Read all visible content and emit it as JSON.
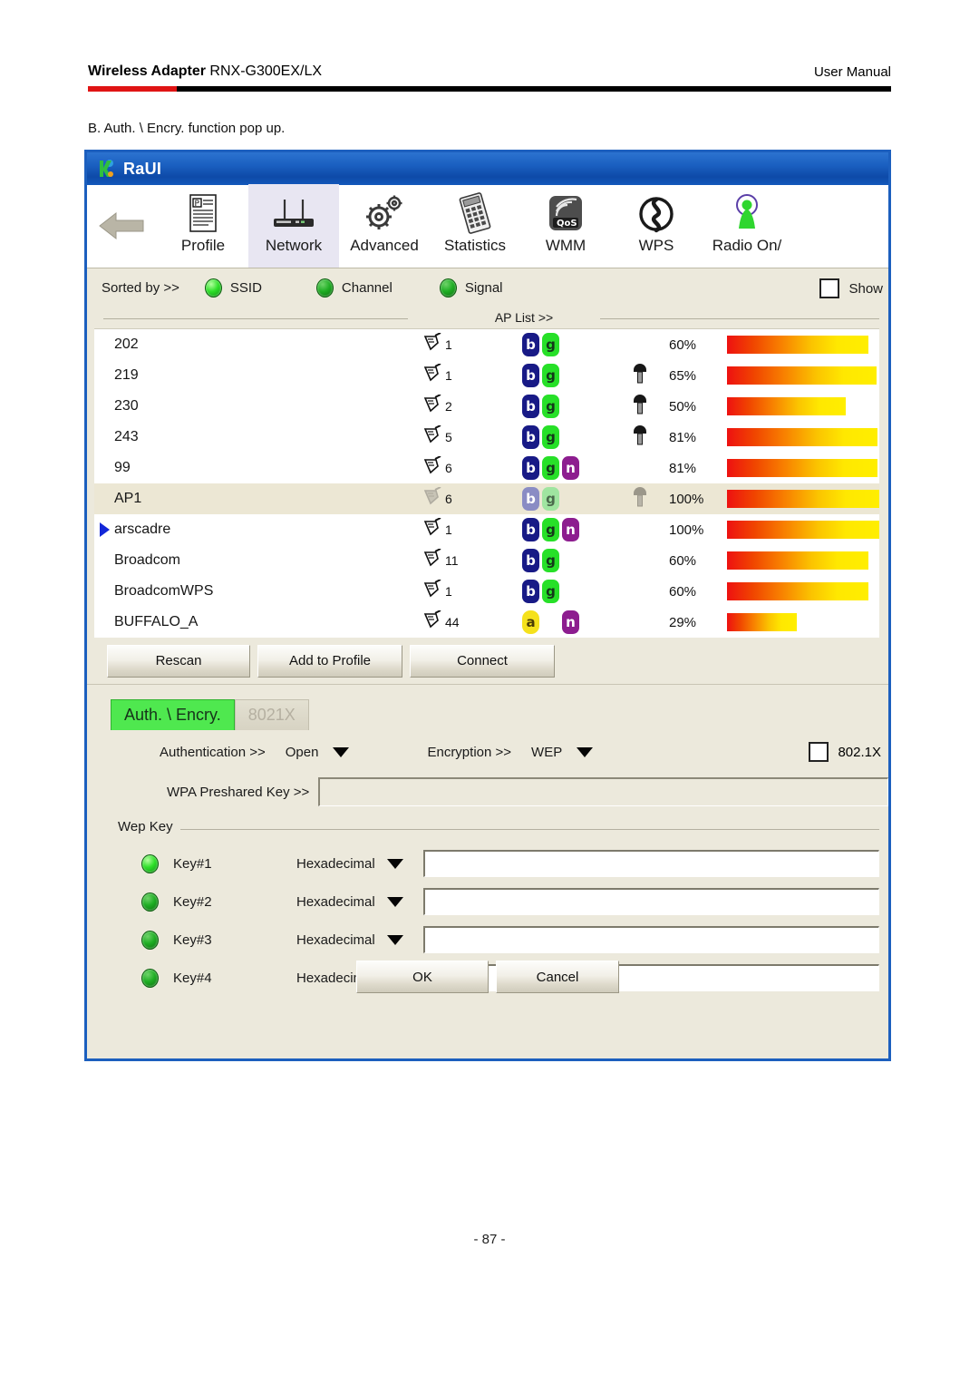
{
  "document": {
    "header_left_bold": "Wireless Adapter",
    "header_left_model": " RNX-G300EX/LX",
    "header_right": "User Manual",
    "caption": "B. Auth. \\ Encry. function pop up.",
    "page_number": "- 87 -",
    "accent_red": "#e01414",
    "accent_black": "#000000"
  },
  "window": {
    "title": "RaUI",
    "titlebar_color": "#1a5fc0",
    "body_color": "#ece9dc",
    "border_color": "#1c5fbe"
  },
  "toolbar": {
    "back_icon": "back-arrow-icon",
    "items": [
      {
        "label": "Profile",
        "icon": "profile-icon",
        "active": false
      },
      {
        "label": "Network",
        "icon": "network-icon",
        "active": true
      },
      {
        "label": "Advanced",
        "icon": "advanced-icon",
        "active": false
      },
      {
        "label": "Statistics",
        "icon": "statistics-icon",
        "active": false
      },
      {
        "label": "WMM",
        "icon": "wmm-qos-icon",
        "active": false
      },
      {
        "label": "WPS",
        "icon": "wps-icon",
        "active": false
      },
      {
        "label": "Radio On/",
        "icon": "radio-onoff-icon",
        "active": false
      }
    ]
  },
  "sortbar": {
    "label": "Sorted by >>",
    "options": [
      {
        "label": "SSID",
        "selected": true
      },
      {
        "label": "Channel",
        "selected": false
      },
      {
        "label": "Signal",
        "selected": false
      }
    ],
    "show_checkbox": {
      "label": "Show",
      "checked": false
    }
  },
  "ap_list": {
    "header": "AP List >>",
    "rows": [
      {
        "ssid": "202",
        "channel": "1",
        "caps": [
          "b",
          "g"
        ],
        "locked": false,
        "signal": "60%",
        "signal_value": 60,
        "selected": false,
        "marked": false,
        "dimmed": false
      },
      {
        "ssid": "219",
        "channel": "1",
        "caps": [
          "b",
          "g"
        ],
        "locked": true,
        "signal": "65%",
        "signal_value": 65,
        "selected": false,
        "marked": false,
        "dimmed": false
      },
      {
        "ssid": "230",
        "channel": "2",
        "caps": [
          "b",
          "g"
        ],
        "locked": true,
        "signal": "50%",
        "signal_value": 50,
        "selected": false,
        "marked": false,
        "dimmed": false
      },
      {
        "ssid": "243",
        "channel": "5",
        "caps": [
          "b",
          "g"
        ],
        "locked": true,
        "signal": "81%",
        "signal_value": 81,
        "selected": false,
        "marked": false,
        "dimmed": false
      },
      {
        "ssid": "99",
        "channel": "6",
        "caps": [
          "b",
          "g",
          "n"
        ],
        "locked": false,
        "signal": "81%",
        "signal_value": 81,
        "selected": false,
        "marked": false,
        "dimmed": false
      },
      {
        "ssid": "AP1",
        "channel": "6",
        "caps": [
          "b",
          "g"
        ],
        "locked": true,
        "signal": "100%",
        "signal_value": 100,
        "selected": true,
        "marked": false,
        "dimmed": true
      },
      {
        "ssid": "arscadre",
        "channel": "1",
        "caps": [
          "b",
          "g",
          "n"
        ],
        "locked": false,
        "signal": "100%",
        "signal_value": 100,
        "selected": false,
        "marked": true,
        "dimmed": false
      },
      {
        "ssid": "Broadcom",
        "channel": "11",
        "caps": [
          "b",
          "g"
        ],
        "locked": false,
        "signal": "60%",
        "signal_value": 60,
        "selected": false,
        "marked": false,
        "dimmed": false
      },
      {
        "ssid": "BroadcomWPS",
        "channel": "1",
        "caps": [
          "b",
          "g"
        ],
        "locked": false,
        "signal": "60%",
        "signal_value": 60,
        "selected": false,
        "marked": false,
        "dimmed": false
      },
      {
        "ssid": "BUFFALO_A",
        "channel": "44",
        "caps": [
          "a",
          "_",
          "n"
        ],
        "locked": false,
        "signal": "29%",
        "signal_value": 29,
        "selected": false,
        "marked": false,
        "dimmed": false
      }
    ],
    "actions": {
      "rescan": "Rescan",
      "add_to_profile": "Add to Profile",
      "connect": "Connect"
    }
  },
  "auth_panel": {
    "tabs": [
      {
        "label": "Auth. \\ Encry.",
        "active": true
      },
      {
        "label": "8021X",
        "active": false
      }
    ],
    "authentication_label": "Authentication >>",
    "authentication_value": "Open",
    "encryption_label": "Encryption >>",
    "encryption_value": "WEP",
    "checkbox_8021x": {
      "label": "802.1X",
      "checked": false
    },
    "wpa_psk_label": "WPA Preshared Key >>",
    "wpa_psk_value": "",
    "wep_key_legend": "Wep Key",
    "wep_keys": [
      {
        "label": "Key#1",
        "format": "Hexadecimal",
        "value": "",
        "selected": true
      },
      {
        "label": "Key#2",
        "format": "Hexadecimal",
        "value": "",
        "selected": false
      },
      {
        "label": "Key#3",
        "format": "Hexadecimal",
        "value": "",
        "selected": false
      },
      {
        "label": "Key#4",
        "format": "Hexadecimal",
        "value": "",
        "selected": false
      }
    ],
    "ok_label": "OK",
    "cancel_label": "Cancel"
  }
}
